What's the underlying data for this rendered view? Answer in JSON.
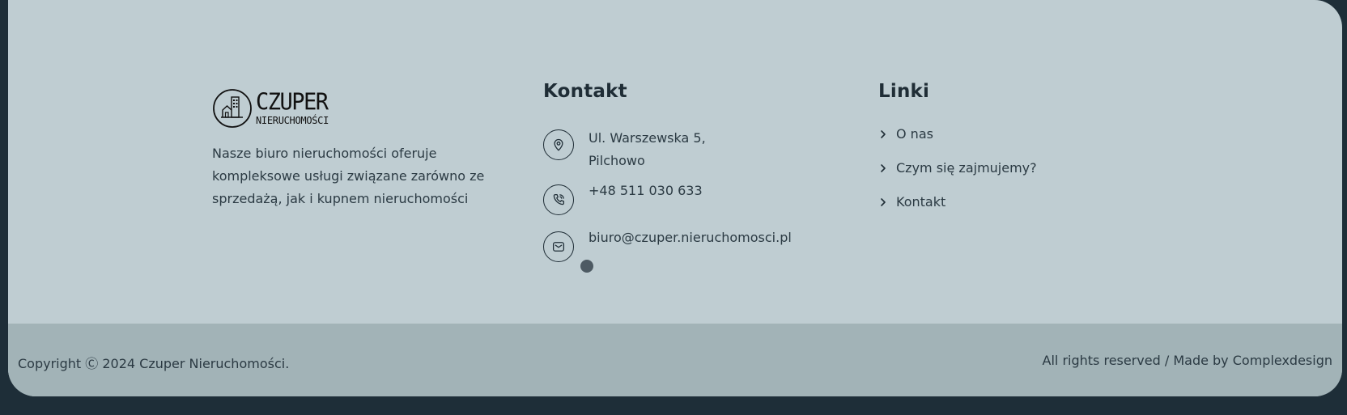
{
  "brand": {
    "logo_title": "CZUPER",
    "logo_subtitle": "NIERUCHOMOŚCI",
    "description": "Nasze biuro nieruchomości oferuje kompleksowe usługi związane zarówno ze sprzedażą, jak i kupnem nieruchomości"
  },
  "contact": {
    "title": "Kontakt",
    "address_line1": "Ul. Warszewska 5,",
    "address_line2": "Pilchowo",
    "phone": "+48 511 030 633",
    "email": "biuro@czuper.nieruchomosci.pl"
  },
  "links": {
    "title": "Linki",
    "items": [
      {
        "label": "O nas"
      },
      {
        "label": "Czym się zajmujemy?"
      },
      {
        "label": "Kontakt"
      }
    ]
  },
  "bottom": {
    "copyright": "Copyright Ⓒ 2024 Czuper Nieruchomości.",
    "rights": "All rights reserved / Made by Complexdesign"
  },
  "colors": {
    "page_background": "#1e2e38",
    "footer_background": "#bfcdd2",
    "bottom_bar_background": "#a2b3b7",
    "text": "#1f2d36"
  },
  "icons": {
    "address": "map-pin-icon",
    "phone": "phone-icon",
    "email": "mail-icon",
    "link": "chevron-right-icon"
  }
}
